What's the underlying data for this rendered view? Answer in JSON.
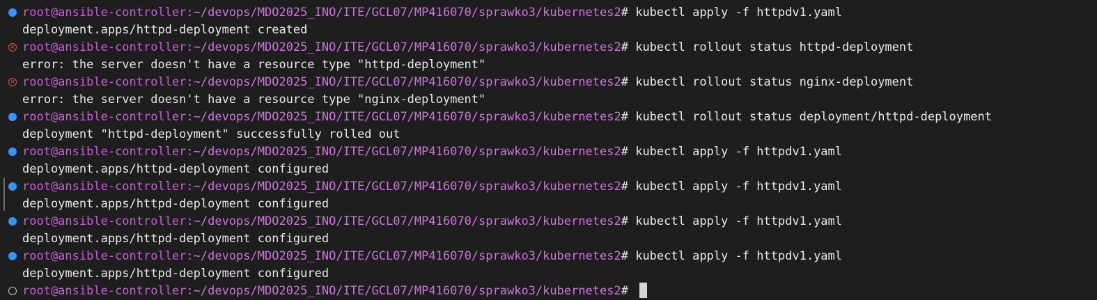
{
  "terminal": {
    "lines": [
      {
        "kind": "prompt",
        "status": "success",
        "user_host": "root@ansible-controller",
        "path": ":~/devops/MDO2025_INO/ITE/GCL07/MP416070/sprawko3/kubernetes2",
        "command": "# kubectl apply -f httpdv1.yaml"
      },
      {
        "kind": "output",
        "text": "deployment.apps/httpd-deployment created"
      },
      {
        "kind": "prompt",
        "status": "error",
        "user_host": "root@ansible-controller",
        "path": ":~/devops/MDO2025_INO/ITE/GCL07/MP416070/sprawko3/kubernetes2",
        "command": "# kubectl rollout status httpd-deployment"
      },
      {
        "kind": "output",
        "text": "error: the server doesn't have a resource type \"httpd-deployment\""
      },
      {
        "kind": "prompt",
        "status": "error",
        "user_host": "root@ansible-controller",
        "path": ":~/devops/MDO2025_INO/ITE/GCL07/MP416070/sprawko3/kubernetes2",
        "command": "# kubectl rollout status nginx-deployment"
      },
      {
        "kind": "output",
        "text": "error: the server doesn't have a resource type \"nginx-deployment\""
      },
      {
        "kind": "prompt",
        "status": "success",
        "user_host": "root@ansible-controller",
        "path": ":~/devops/MDO2025_INO/ITE/GCL07/MP416070/sprawko3/kubernetes2",
        "command": "# kubectl rollout status deployment/httpd-deployment"
      },
      {
        "kind": "output",
        "text": "deployment \"httpd-deployment\" successfully rolled out"
      },
      {
        "kind": "prompt",
        "status": "success",
        "user_host": "root@ansible-controller",
        "path": ":~/devops/MDO2025_INO/ITE/GCL07/MP416070/sprawko3/kubernetes2",
        "command": "# kubectl apply -f httpdv1.yaml"
      },
      {
        "kind": "output",
        "text": "deployment.apps/httpd-deployment configured"
      },
      {
        "kind": "prompt",
        "status": "success",
        "user_host": "root@ansible-controller",
        "path": ":~/devops/MDO2025_INO/ITE/GCL07/MP416070/sprawko3/kubernetes2",
        "command": "# kubectl apply -f httpdv1.yaml"
      },
      {
        "kind": "output",
        "text": "deployment.apps/httpd-deployment configured"
      },
      {
        "kind": "prompt",
        "status": "success",
        "user_host": "root@ansible-controller",
        "path": ":~/devops/MDO2025_INO/ITE/GCL07/MP416070/sprawko3/kubernetes2",
        "command": "# kubectl apply -f httpdv1.yaml"
      },
      {
        "kind": "output",
        "text": "deployment.apps/httpd-deployment configured"
      },
      {
        "kind": "prompt",
        "status": "success",
        "user_host": "root@ansible-controller",
        "path": ":~/devops/MDO2025_INO/ITE/GCL07/MP416070/sprawko3/kubernetes2",
        "command": "# kubectl apply -f httpdv1.yaml"
      },
      {
        "kind": "output",
        "text": "deployment.apps/httpd-deployment configured"
      },
      {
        "kind": "prompt",
        "status": "pending",
        "user_host": "root@ansible-controller",
        "path": ":~/devops/MDO2025_INO/ITE/GCL07/MP416070/sprawko3/kubernetes2",
        "command": "# "
      }
    ]
  },
  "colors": {
    "background": "#1e1e1e",
    "user_host": "#c660d4",
    "path": "#ca76d9",
    "text": "#e8e8e8",
    "success_marker": "#3794ff",
    "error_marker": "#f14c4c"
  },
  "icons": {
    "success": "circle-filled-icon",
    "error": "circle-x-icon",
    "pending": "circle-outline-icon"
  }
}
